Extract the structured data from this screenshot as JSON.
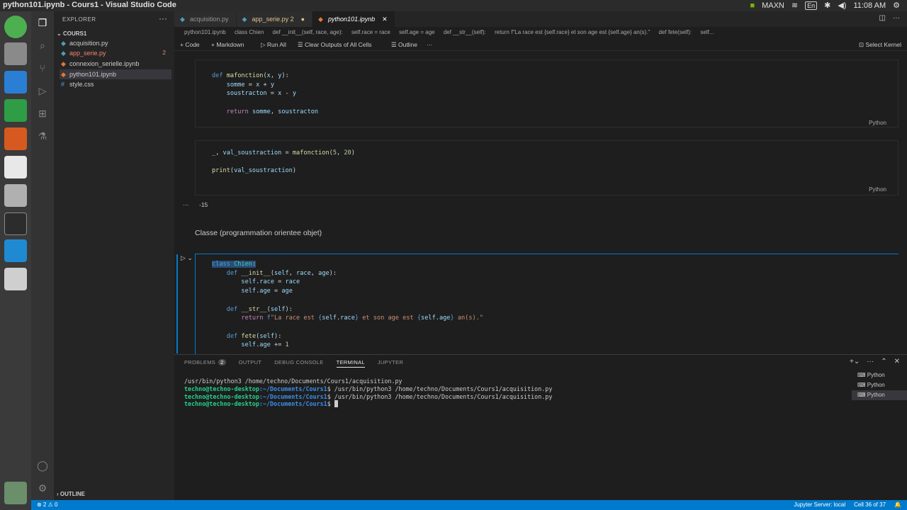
{
  "window": {
    "title": "python101.ipynb - Cours1 - Visual Studio Code"
  },
  "tray": {
    "maxn": "MAXN",
    "lang": "En",
    "time": "11:08 AM"
  },
  "explorer": {
    "header": "EXPLORER",
    "folder": "COURS1",
    "files": [
      {
        "name": "acquisition.py",
        "badge": ""
      },
      {
        "name": "app_serie.py",
        "badge": "2"
      },
      {
        "name": "connexion_serielle.ipynb",
        "badge": ""
      },
      {
        "name": "python101.ipynb",
        "badge": ""
      },
      {
        "name": "style.css",
        "badge": ""
      }
    ],
    "outline": "OUTLINE"
  },
  "tabs": [
    {
      "label": "acquisition.py"
    },
    {
      "label": "app_serie.py 2"
    },
    {
      "label": "python101.ipynb"
    }
  ],
  "breadcrumb": [
    "python101.ipynb",
    "class Chien",
    "def __init__(self, race, age):",
    "self.race = race",
    "self.age = age",
    "def __str__(self):",
    "return f\"La race est {self.race} et son age est {self.age} an(s).\"",
    "def fete(self):",
    "self..."
  ],
  "notebook_toolbar": {
    "code": "Code",
    "markdown": "Markdown",
    "run_all": "Run All",
    "clear_outputs": "Clear Outputs of All Cells",
    "outline": "Outline",
    "select_kernel": "Select Kernel"
  },
  "cells": {
    "lang": "Python",
    "output1": "-15",
    "markdown1": "Classe (programmation orientee objet)"
  },
  "panel": {
    "tabs": [
      "PROBLEMS",
      "OUTPUT",
      "DEBUG CONSOLE",
      "TERMINAL",
      "JUPYTER"
    ],
    "problems_count": "2",
    "terminal_lines": [
      "/usr/bin/python3 /home/techno/Documents/Cours1/acquisition.py"
    ],
    "prompt_user": "techno@techno-desktop",
    "prompt_path": ":~/Documents/Cours1",
    "cmd": "$ /usr/bin/python3 /home/techno/Documents/Cours1/acquisition.py",
    "prompt_end": "$ ",
    "terminals": [
      "Python",
      "Python",
      "Python"
    ]
  },
  "status": {
    "left": "⊗ 2 ⚠ 0",
    "jupyter": "Jupyter Server: local",
    "cell": "Cell 36 of 37"
  }
}
